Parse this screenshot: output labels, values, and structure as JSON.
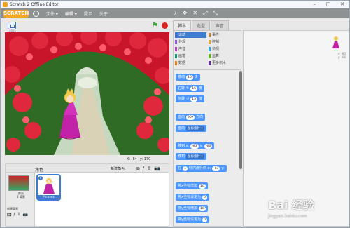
{
  "window": {
    "title": "Scratch 2 Offline Editor",
    "controls": [
      "–",
      "□",
      "✕"
    ]
  },
  "menubar": {
    "logo": "SCRATCH",
    "items": [
      "文件 ▾",
      "编辑 ▾",
      "提示",
      "关于"
    ],
    "tools": [
      "⇩",
      "✥",
      "✕",
      "⤢",
      "⤡"
    ]
  },
  "stage": {
    "version": "v461",
    "coord_x_label": "X: -84",
    "coord_y_label": "y: 170"
  },
  "sprites": {
    "header_label": "角色",
    "new_sprite_label": "新建角色:",
    "new_icons": [
      "⛂",
      "/",
      "⇧",
      "📷"
    ],
    "stage_name": "舞台",
    "stage_sub": "2 背景",
    "new_backdrop_label": "新建背景",
    "backdrop_icons": [
      "🖾",
      "/",
      "⇧",
      "📷"
    ],
    "sprite_name": "Princess",
    "info_icon": "i"
  },
  "tabs": [
    "脚本",
    "造型",
    "声音"
  ],
  "categories": [
    {
      "label": "运动",
      "color": "#4a6cd4",
      "active": true
    },
    {
      "label": "外观",
      "color": "#8a55d7"
    },
    {
      "label": "声音",
      "color": "#bb42c3"
    },
    {
      "label": "画笔",
      "color": "#0e9a6c"
    },
    {
      "label": "数据",
      "color": "#ee7d16"
    },
    {
      "label": "事件",
      "color": "#c88330"
    },
    {
      "label": "控制",
      "color": "#e1a91a"
    },
    {
      "label": "侦测",
      "color": "#2ca5e2"
    },
    {
      "label": "运算",
      "color": "#5cb712"
    },
    {
      "label": "更多积木",
      "color": "#632d99"
    }
  ],
  "blocks": [
    {
      "pre": "移动",
      "slot": "10",
      "post": "步"
    },
    {
      "pre": "右转",
      "sym": "↻",
      "slot": "15",
      "post": "度"
    },
    {
      "pre": "左转",
      "sym": "↺",
      "slot": "15",
      "post": "度"
    },
    {
      "pre": "面向",
      "slot": "90▾",
      "post": "方向"
    },
    {
      "pre": "面向",
      "dd": "鼠标指针 ▾",
      "post": ""
    },
    {
      "pre": "移到 x:",
      "slot": "-83",
      "post": "y:",
      "slot2": "-66"
    },
    {
      "pre": "移到",
      "dd": "鼠标指针 ▾",
      "post": ""
    },
    {
      "pre": "在",
      "slot": "1",
      "post": "秒内滑行到 x:",
      "slot2": "-83",
      "post2": "y:"
    },
    {
      "pre": "将x坐标增加",
      "slot": "10",
      "post": ""
    },
    {
      "pre": "将x坐标设定为",
      "slot": "0",
      "post": ""
    },
    {
      "pre": "将y坐标增加",
      "slot": "10",
      "post": ""
    },
    {
      "pre": "将y坐标设定为",
      "slot": "0",
      "post": ""
    }
  ],
  "script_area": {
    "sprite_x": "x: -83",
    "sprite_y": "y: -66"
  },
  "watermark": {
    "main": "Bai 经验",
    "sub": "jingyan.baidu.com"
  },
  "colors": {
    "motion": "#4c97ff",
    "menubar": "#8d9192",
    "accent": "#3f7ccf"
  }
}
